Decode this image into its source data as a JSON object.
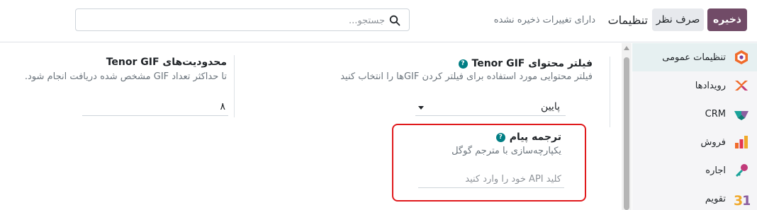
{
  "toolbar": {
    "save_label": "ذخیره",
    "discard_label": "صرف نظر",
    "page_title": "تنظیمات",
    "unsaved_text": "دارای تغییرات ذخیره نشده"
  },
  "search": {
    "placeholder": "جستجو...",
    "value": ""
  },
  "sidebar": {
    "items": [
      {
        "label": "تنظیمات عمومی",
        "icon": "general-settings-icon",
        "active": true
      },
      {
        "label": "رویدادها",
        "icon": "events-icon",
        "active": false
      },
      {
        "label": "CRM",
        "icon": "crm-icon",
        "active": false
      },
      {
        "label": "فروش",
        "icon": "sales-icon",
        "active": false
      },
      {
        "label": "اجاره",
        "icon": "rental-icon",
        "active": false
      },
      {
        "label": "تقویم",
        "icon": "calendar-icon",
        "active": false
      }
    ]
  },
  "settings": {
    "content_filter": {
      "title": "فیلتر محتوای Tenor GIF",
      "description": "فیلتر محتوایی مورد استفاده برای فیلتر کردن GIFها را انتخاب کنید",
      "selected": "پایین"
    },
    "limits": {
      "title": "محدودیت‌های Tenor GIF",
      "description": "تا حداکثر تعداد GIF مشخص شده دریافت انجام شود.",
      "value": "۸"
    },
    "translation": {
      "title": "ترجمه پیام",
      "description": "یکپارچه‌سازی با مترجم گوگل",
      "api_placeholder": "کلید API خود را وارد کنید",
      "api_value": ""
    }
  },
  "colors": {
    "brand": "#714b67",
    "help": "#017e84",
    "highlight": "#e0191c",
    "active_item_bg": "#e6f0f1"
  }
}
